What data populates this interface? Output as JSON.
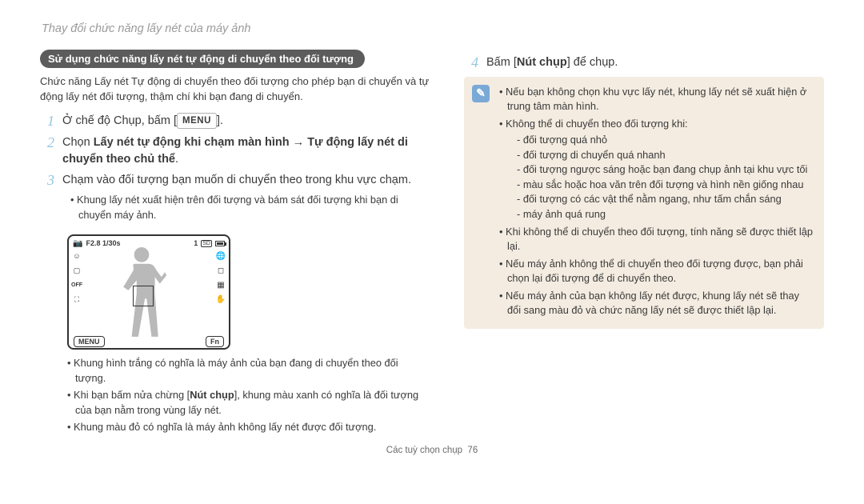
{
  "header": "Thay đổi chức năng lấy nét của máy ảnh",
  "section_tag": "Sử dụng chức năng lấy nét tự động di chuyển theo đối tượng",
  "intro": "Chức năng Lấy nét Tự động di chuyển theo đối tượng cho phép bạn di chuyển và tự động lấy nét đối tượng, thậm chí khi bạn đang di chuyển.",
  "step1_pre": "Ở chế độ Chụp, bấm [",
  "step1_key": "MENU",
  "step1_post": "].",
  "step2_pre": "Chọn ",
  "step2_bold1": "Lấy nét tự động khi chạm màn hình",
  "step2_arrow": " → ",
  "step2_bold2": "Tự động lấy nét di chuyển theo chủ thể",
  "step2_post": ".",
  "step3": "Chạm vào đối tượng bạn muốn di chuyển theo trong khu vực chạm.",
  "step3_bullet": "Khung lấy nét xuất hiện trên đối tượng và bám sát đối tượng khi bạn di chuyển máy ảnh.",
  "lcd": {
    "exposure": "F2.8 1/30s",
    "count": "1",
    "menu": "MENU",
    "fn": "Fn"
  },
  "after_bullets": {
    "b1": "Khung hình trắng có nghĩa là máy ảnh của bạn đang di chuyển theo đối tượng.",
    "b2_pre": "Khi bạn bấm nửa chừng [",
    "b2_bold": "Nút chụp",
    "b2_post": "], khung màu xanh có nghĩa là đối tượng của bạn nằm trong vùng lấy nét.",
    "b3": "Khung màu đỏ có nghĩa là máy ảnh không lấy nét được đối tượng."
  },
  "step4_pre": "Bấm [",
  "step4_bold": "Nút chụp",
  "step4_post": "] để chụp.",
  "notes": {
    "n1": "Nếu bạn không chọn khu vực lấy nét, khung lấy nét sẽ xuất hiện ở trung tâm màn hình.",
    "n2": "Không thể di chuyển theo đối tượng khi:",
    "n2subs": [
      "đối tượng quá nhỏ",
      "đối tượng di chuyển quá nhanh",
      "đối tượng ngược sáng hoặc bạn đang chụp ảnh tại khu vực tối",
      "màu sắc hoặc hoa văn trên đối tượng và hình nền giống nhau",
      "đối tượng có các vật thể nằm ngang, như tấm chắn sáng",
      "máy ảnh quá rung"
    ],
    "n3": "Khi không thể di chuyển theo đối tượng, tính năng sẽ được thiết lập lại.",
    "n4": "Nếu máy ảnh không thể di chuyển theo đối tượng được, bạn phải chọn lại đối tượng để di chuyển theo.",
    "n5": "Nếu máy ảnh của bạn không lấy nét được, khung lấy nét sẽ thay đổi sang màu đỏ và chức năng lấy nét sẽ được thiết lập lại."
  },
  "footer_label": "Các tuỳ chọn chụp",
  "footer_page": "76"
}
